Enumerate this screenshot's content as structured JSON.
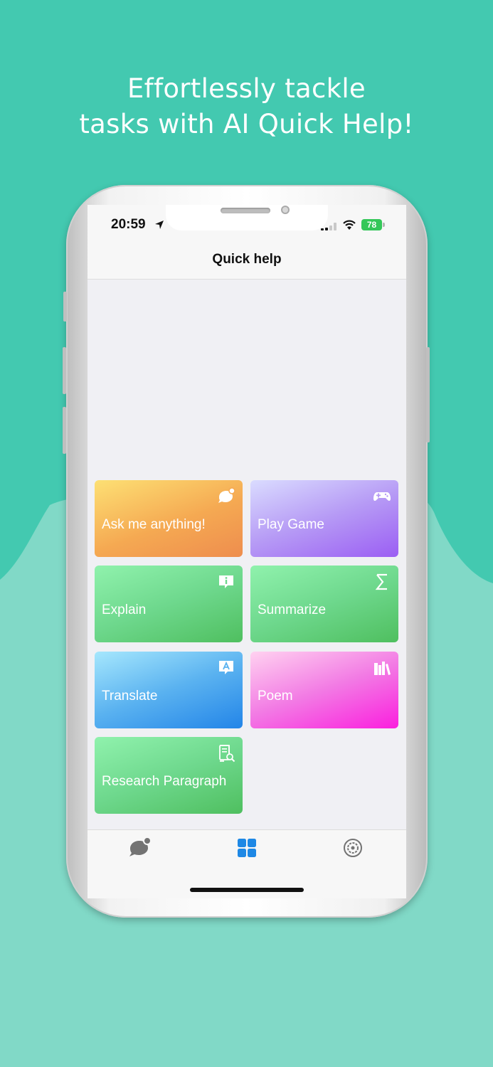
{
  "headline": {
    "line1": "Effortlessly tackle",
    "line2": "tasks with AI Quick Help!"
  },
  "status_bar": {
    "time": "20:59",
    "battery": "78"
  },
  "nav": {
    "title": "Quick help"
  },
  "cards": [
    {
      "label": "Ask me anything!",
      "icon": "chat-bubble-icon"
    },
    {
      "label": "Play Game",
      "icon": "gamepad-icon"
    },
    {
      "label": "Explain",
      "icon": "info-bubble-icon"
    },
    {
      "label": "Summarize",
      "icon": "sigma-icon"
    },
    {
      "label": "Translate",
      "icon": "translate-bubble-icon"
    },
    {
      "label": "Poem",
      "icon": "books-icon"
    },
    {
      "label": "Research Paragraph",
      "icon": "document-search-icon"
    }
  ],
  "tabs": [
    {
      "icon": "chat-tab-icon",
      "selected": false
    },
    {
      "icon": "grid-tab-icon",
      "selected": true
    },
    {
      "icon": "settings-tab-icon",
      "selected": false
    }
  ],
  "colors": {
    "background_top": "#43c9b0",
    "background_bottom": "#81d9c7",
    "tab_active": "#1e88e5",
    "tab_inactive": "#737373"
  }
}
